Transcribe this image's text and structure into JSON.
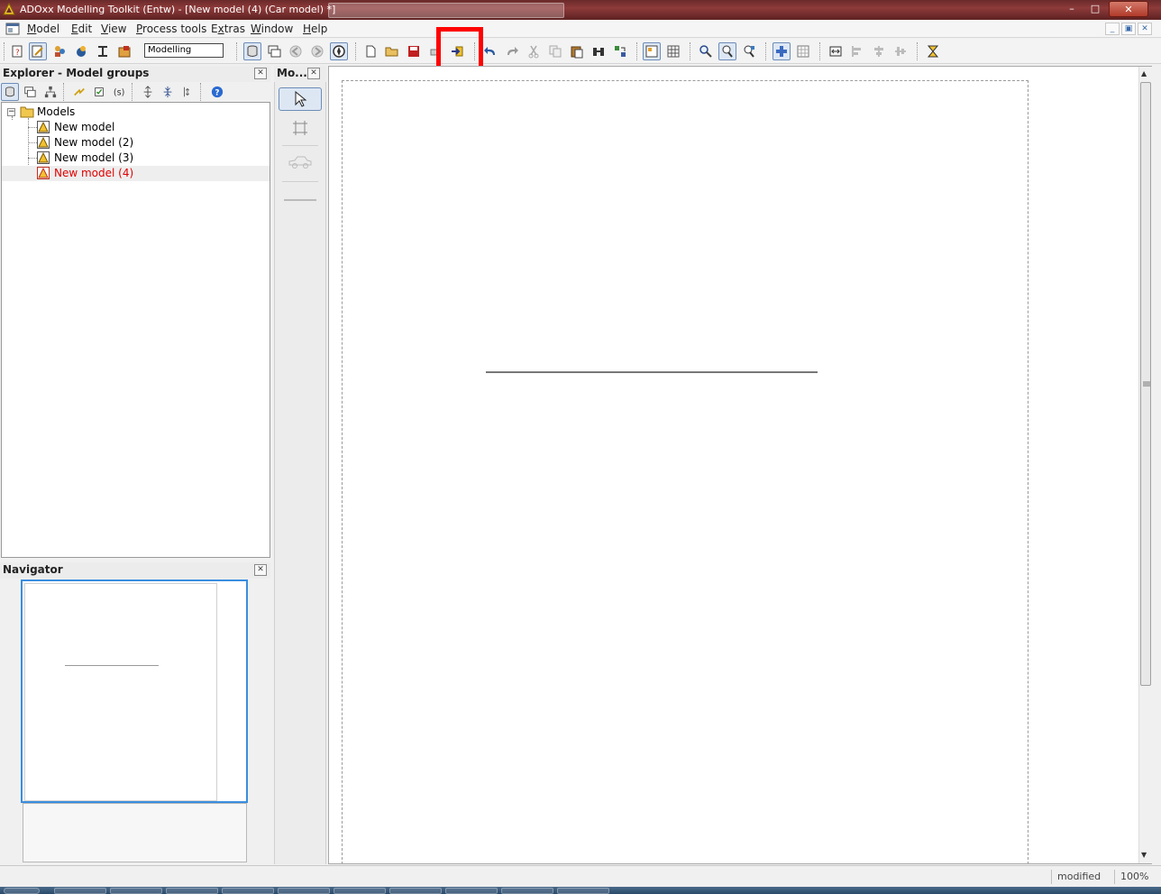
{
  "window": {
    "title": "ADOxx Modelling Toolkit (Entw) - [New model (4) (Car model) *]",
    "controls": {
      "minimize": "–",
      "maximize": "□",
      "close": "✕"
    }
  },
  "menu": {
    "items": [
      {
        "label": "Model",
        "key": "M"
      },
      {
        "label": "Edit",
        "key": "E"
      },
      {
        "label": "View",
        "key": "V"
      },
      {
        "label": "Process tools",
        "key": "P"
      },
      {
        "label": "Extras",
        "key": "x"
      },
      {
        "label": "Window",
        "key": "W"
      },
      {
        "label": "Help",
        "key": "H"
      }
    ],
    "mdi_controls": {
      "minimize": "_",
      "restore": "▣",
      "close": "✕"
    }
  },
  "toolbar": {
    "mode_value": "Modelling"
  },
  "explorer": {
    "title": "Explorer - Model groups",
    "close": "✕",
    "tree": {
      "root": "Models",
      "expander": "−",
      "items": [
        {
          "label": "New model",
          "selected": false
        },
        {
          "label": "New model (2)",
          "selected": false
        },
        {
          "label": "New model (3)",
          "selected": false
        },
        {
          "label": "New model (4)",
          "selected": true
        }
      ]
    }
  },
  "modelling_bar": {
    "title": "Mo...",
    "close": "✕"
  },
  "navigator": {
    "title": "Navigator",
    "close": "✕"
  },
  "statusbar": {
    "state": "modified",
    "zoom": "100%"
  },
  "colors": {
    "highlight": "#ff0000",
    "selected_text": "#e00000",
    "nav_frame": "#3a8ee0"
  }
}
